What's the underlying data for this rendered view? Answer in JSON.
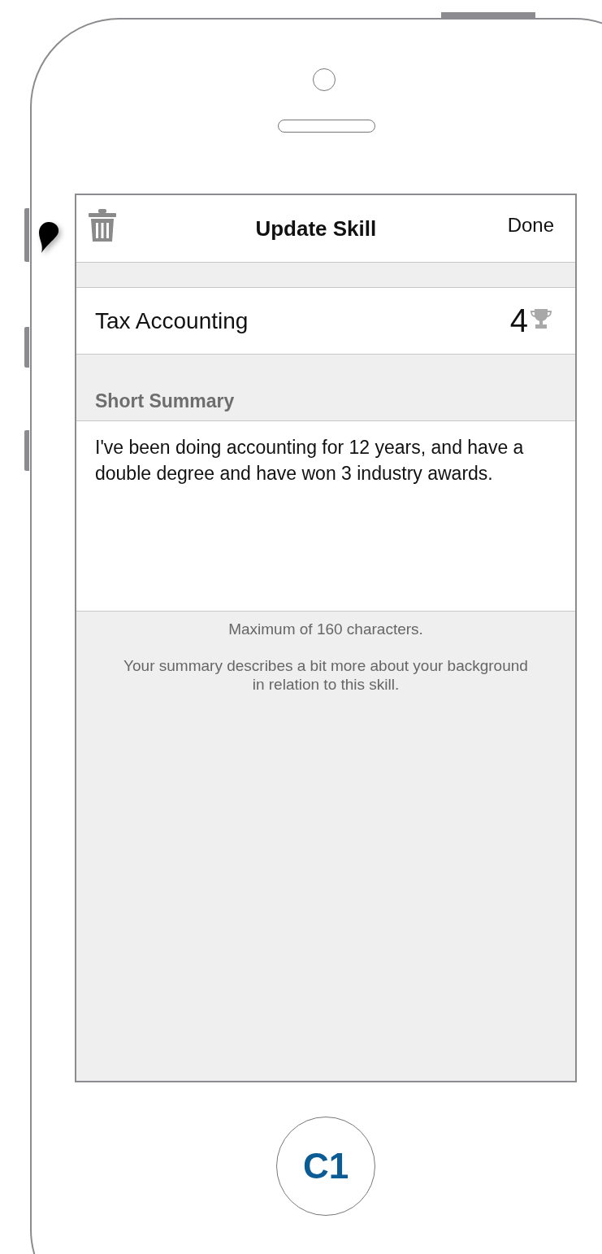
{
  "nav_bar": {
    "title": "Update Skill",
    "action": "Done"
  },
  "skill": {
    "name": "Tax Accounting",
    "rating": "4"
  },
  "summary": {
    "label": "Short Summary",
    "value": "I've been doing accounting for 12 years, and have a double degree and have won 3 industry awards."
  },
  "hints": [
    "Maximum of 160 characters.",
    "Your summary describes a bit more about your background in relation to this skill."
  ],
  "home_button": {
    "label": "C1"
  }
}
